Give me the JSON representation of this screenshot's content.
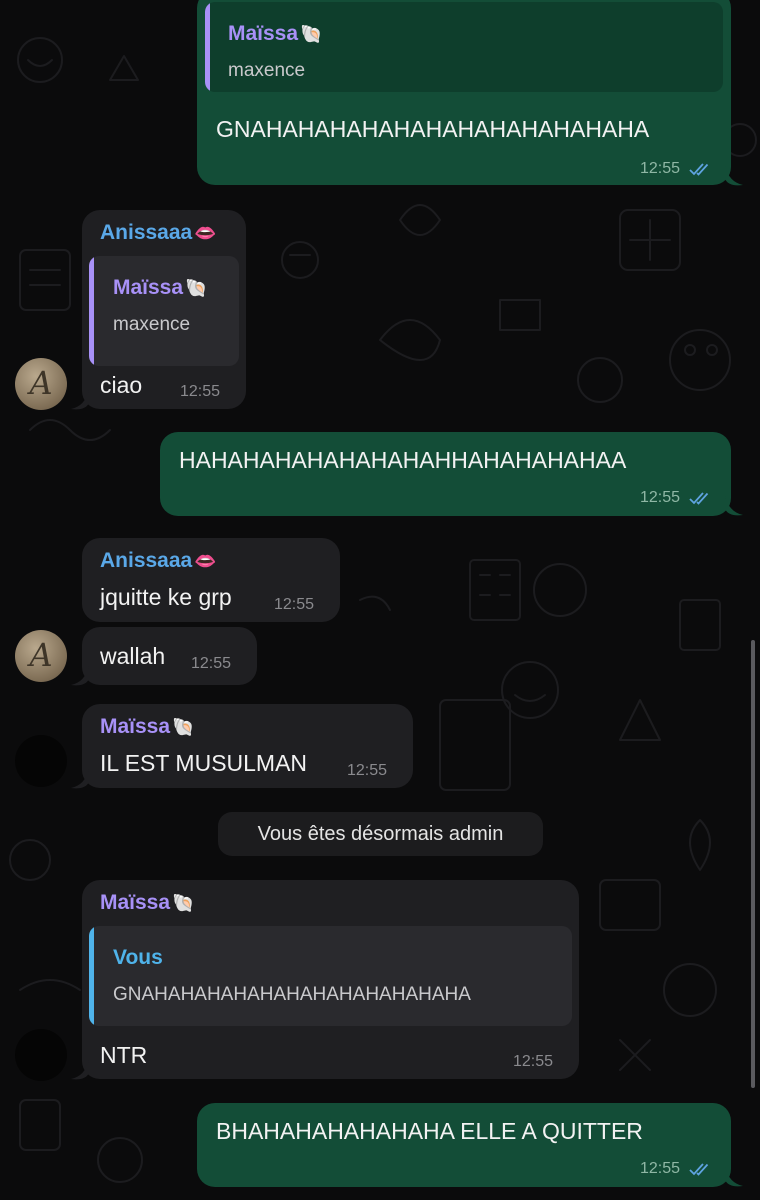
{
  "colors": {
    "outgoing_bubble": "#134d37",
    "incoming_bubble": "#1f1f22",
    "maissa_name": "#a891f7",
    "anissaaa_name": "#5aa8e8",
    "vous_quote": "#4fb3ea",
    "read_ticks": "#5fa3e0",
    "background": "#0b0b0c"
  },
  "messages": [
    {
      "direction": "outgoing",
      "quote": {
        "sender": "Maïssa",
        "sender_emoji": "🐚",
        "text": "maxence"
      },
      "text": "GNAHAHAHAHAHAHAHAHAHAHAHAHA",
      "time": "12:55",
      "status": "read"
    },
    {
      "direction": "incoming",
      "sender": "Anissaaa",
      "sender_emoji": "👄",
      "avatar": "A",
      "quote": {
        "sender": "Maïssa",
        "sender_emoji": "🐚",
        "text": "maxence"
      },
      "text": "ciao",
      "time": "12:55"
    },
    {
      "direction": "outgoing",
      "text": "HAHAHAHAHAHAHAHAHHAHAHAHAHAA",
      "time": "12:55",
      "status": "read"
    },
    {
      "direction": "incoming",
      "sender": "Anissaaa",
      "sender_emoji": "👄",
      "text": "jquitte ke grp",
      "time": "12:55"
    },
    {
      "direction": "incoming",
      "avatar": "A",
      "text": "wallah",
      "time": "12:55"
    },
    {
      "direction": "incoming",
      "sender": "Maïssa",
      "sender_emoji": "🐚",
      "avatar": "",
      "text": "IL EST MUSULMAN",
      "time": "12:55"
    },
    {
      "direction": "incoming",
      "sender": "Maïssa",
      "sender_emoji": "🐚",
      "avatar": "",
      "quote": {
        "sender": "Vous",
        "text": "GNAHAHAHAHAHAHAHAHAHAHAHAHA"
      },
      "text": "NTR",
      "time": "12:55"
    },
    {
      "direction": "outgoing",
      "text": "BHAHAHAHAHAHAHA ELLE A QUITTER",
      "time": "12:55",
      "status": "read"
    }
  ],
  "system_message": "Vous êtes désormais admin",
  "icons": {
    "read_ticks": "double-check-icon",
    "avatar_anissaaa": "avatar-letter-a",
    "avatar_maissa": "avatar-dark"
  }
}
